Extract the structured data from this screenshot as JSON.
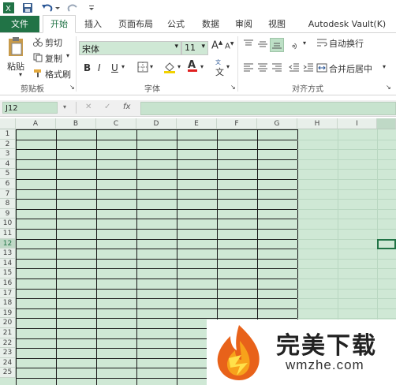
{
  "quick_access": {
    "icons": [
      "excel-icon",
      "save-icon",
      "undo-icon",
      "redo-icon",
      "customize-icon"
    ]
  },
  "tabs": [
    {
      "label": "文件"
    },
    {
      "label": "开始"
    },
    {
      "label": "插入"
    },
    {
      "label": "页面布局"
    },
    {
      "label": "公式"
    },
    {
      "label": "数据"
    },
    {
      "label": "审阅"
    },
    {
      "label": "视图"
    },
    {
      "label": "Autodesk Vault(K)"
    }
  ],
  "clipboard": {
    "paste": "粘贴",
    "cut": "剪切",
    "copy": "复制",
    "format_painter": "格式刷",
    "group": "剪贴板"
  },
  "font": {
    "name": "宋体",
    "size": "11",
    "bold": "B",
    "italic": "I",
    "underline": "U",
    "group": "字体",
    "grow": "A",
    "shrink": "A",
    "wen": "文"
  },
  "alignment": {
    "wrap": "自动换行",
    "merge": "合并后居中",
    "group": "对齐方式"
  },
  "formula_bar": {
    "namebox": "J12",
    "cancel": "✕",
    "enter": "✓",
    "fx": "fx"
  },
  "columns": [
    "A",
    "B",
    "C",
    "D",
    "E",
    "F",
    "G",
    "H",
    "I"
  ],
  "rows": [
    "1",
    "2",
    "3",
    "4",
    "5",
    "6",
    "7",
    "8",
    "9",
    "10",
    "11",
    "12",
    "13",
    "14",
    "15",
    "16",
    "17",
    "18",
    "19",
    "20",
    "21",
    "22",
    "23",
    "24",
    "25"
  ],
  "watermark": {
    "title": "完美下载",
    "url": "wmzhe.com"
  },
  "colors": {
    "accent": "#217346",
    "sheet_bg": "#cfe8d5",
    "grid": "#1a1a1a"
  }
}
